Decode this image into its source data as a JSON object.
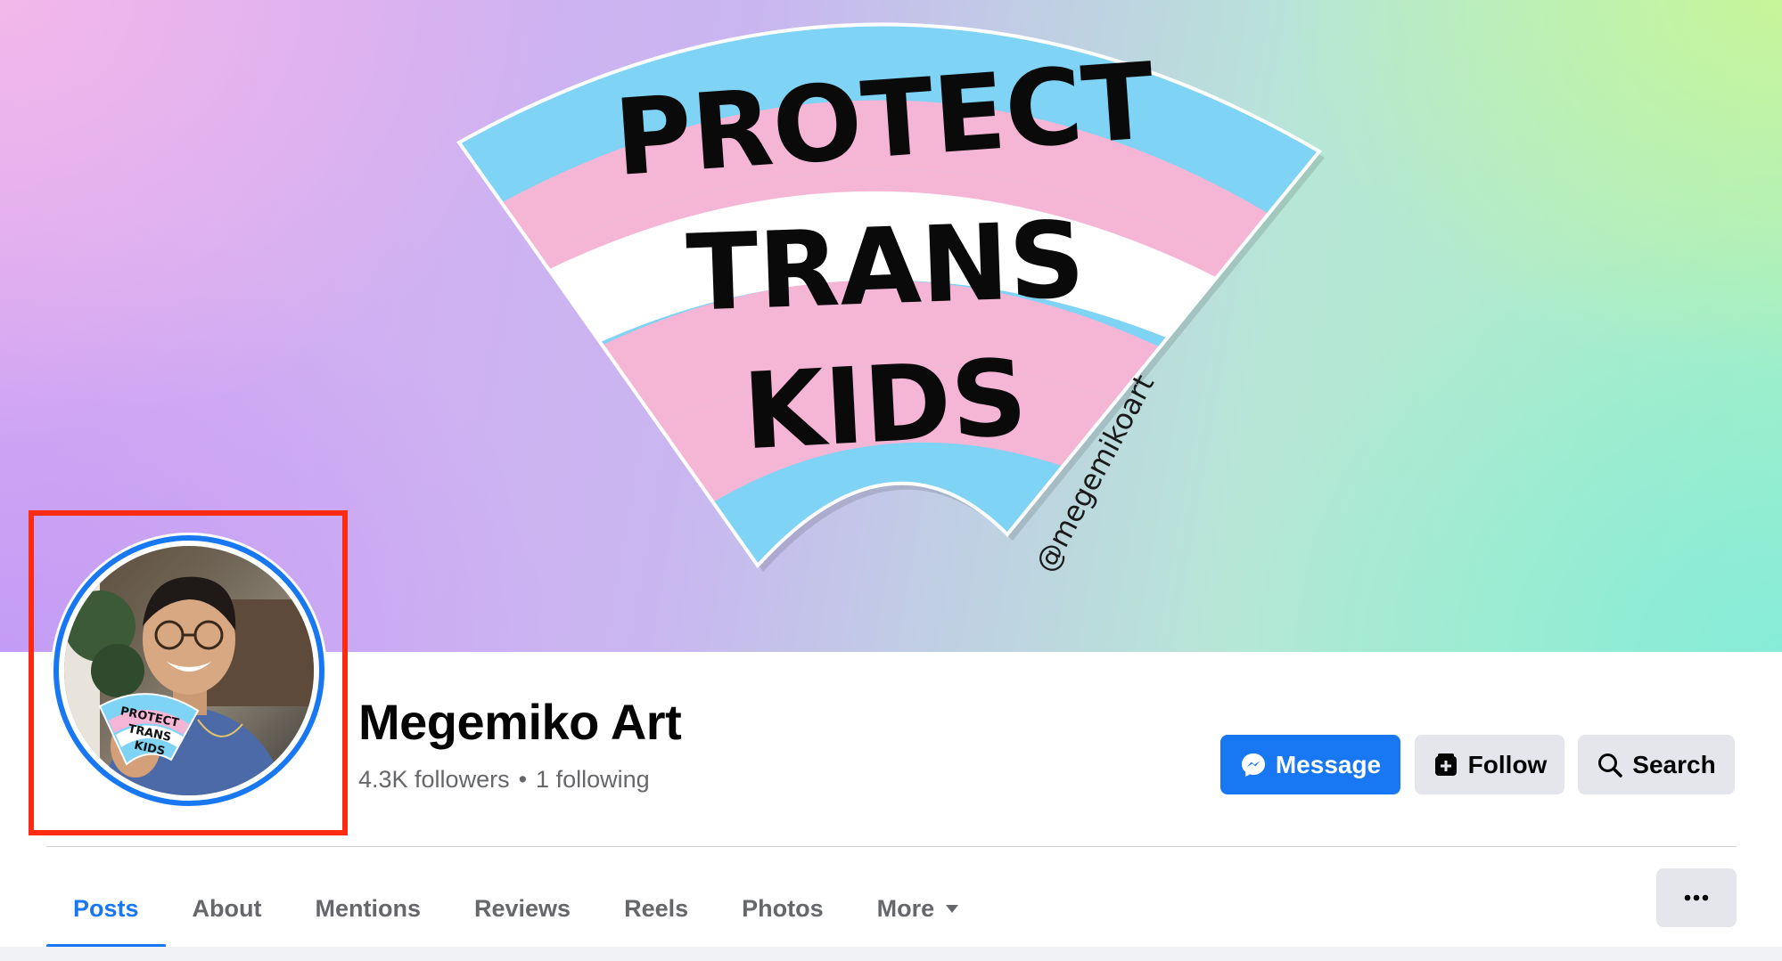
{
  "cover": {
    "sticker_lines": [
      "PROTECT",
      "TRANS",
      "KIDS"
    ],
    "handle": "@megemikoart",
    "colors": {
      "blue": "#7fd3f5",
      "pink": "#f5b6d6",
      "white": "#ffffff"
    }
  },
  "profile": {
    "name": "Megemiko Art",
    "followers": "4.3K followers",
    "separator": "•",
    "following": "1 following",
    "avatar_sticker_lines": [
      "PROTECT",
      "TRANS",
      "KIDS"
    ],
    "highlight_color": "#ff2a12"
  },
  "actions": {
    "message_label": "Message",
    "follow_label": "Follow",
    "search_label": "Search",
    "message_icon": "messenger-icon",
    "follow_icon": "follow-page-icon",
    "search_icon": "search-icon"
  },
  "tabs": [
    {
      "label": "Posts",
      "active": true
    },
    {
      "label": "About"
    },
    {
      "label": "Mentions"
    },
    {
      "label": "Reviews"
    },
    {
      "label": "Reels"
    },
    {
      "label": "Photos"
    },
    {
      "label": "More",
      "icon": "caret-down-icon"
    }
  ],
  "more_options_icon": "ellipsis-icon",
  "accent": "#1877f2"
}
